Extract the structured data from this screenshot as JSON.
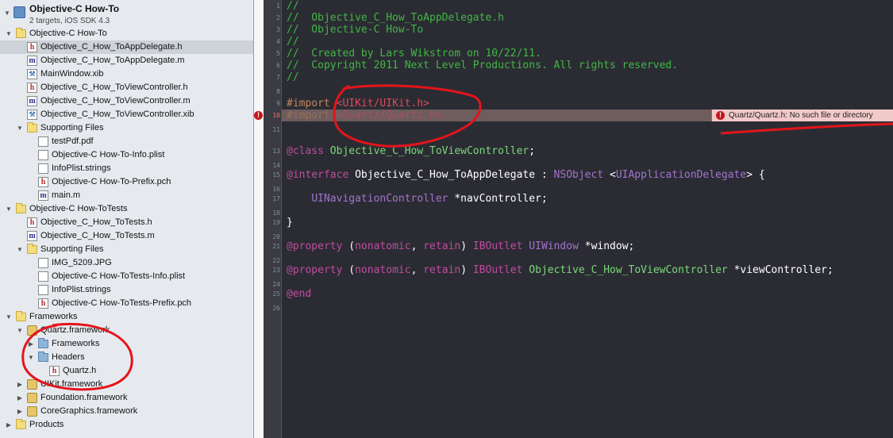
{
  "navigator": {
    "project": {
      "title": "Objective-C How-To",
      "subtitle": "2 targets, iOS SDK 4.3"
    },
    "rows": [
      {
        "label": "Objective-C How-To",
        "icon": "folder-icon",
        "kind": "folder",
        "tri": "▼",
        "indent": 0
      },
      {
        "label": "Objective_C_How_ToAppDelegate.h",
        "icon": "header-file-icon",
        "kind": "hfile",
        "tri": "",
        "indent": 1,
        "selected": true
      },
      {
        "label": "Objective_C_How_ToAppDelegate.m",
        "icon": "implementation-file-icon",
        "kind": "mfile",
        "tri": "",
        "indent": 1
      },
      {
        "label": "MainWindow.xib",
        "icon": "xib-file-icon",
        "kind": "xib",
        "tri": "",
        "indent": 1
      },
      {
        "label": "Objective_C_How_ToViewController.h",
        "icon": "header-file-icon",
        "kind": "hfile",
        "tri": "",
        "indent": 1
      },
      {
        "label": "Objective_C_How_ToViewController.m",
        "icon": "implementation-file-icon",
        "kind": "mfile",
        "tri": "",
        "indent": 1
      },
      {
        "label": "Objective_C_How_ToViewController.xib",
        "icon": "xib-file-icon",
        "kind": "xib",
        "tri": "",
        "indent": 1
      },
      {
        "label": "Supporting Files",
        "icon": "folder-icon",
        "kind": "folder",
        "tri": "▼",
        "indent": 1
      },
      {
        "label": "testPdf.pdf",
        "icon": "document-icon",
        "kind": "doc",
        "tri": "",
        "indent": 2
      },
      {
        "label": "Objective-C How-To-Info.plist",
        "icon": "document-icon",
        "kind": "doc",
        "tri": "",
        "indent": 2
      },
      {
        "label": "InfoPlist.strings",
        "icon": "document-icon",
        "kind": "doc",
        "tri": "",
        "indent": 2
      },
      {
        "label": "Objective-C How-To-Prefix.pch",
        "icon": "header-file-icon",
        "kind": "hfile",
        "tri": "",
        "indent": 2
      },
      {
        "label": "main.m",
        "icon": "implementation-file-icon",
        "kind": "mfile",
        "tri": "",
        "indent": 2
      },
      {
        "label": "Objective-C How-ToTests",
        "icon": "folder-icon",
        "kind": "folder",
        "tri": "▼",
        "indent": 0
      },
      {
        "label": "Objective_C_How_ToTests.h",
        "icon": "header-file-icon",
        "kind": "hfile",
        "tri": "",
        "indent": 1
      },
      {
        "label": "Objective_C_How_ToTests.m",
        "icon": "implementation-file-icon",
        "kind": "mfile",
        "tri": "",
        "indent": 1
      },
      {
        "label": "Supporting Files",
        "icon": "folder-icon",
        "kind": "folder",
        "tri": "▼",
        "indent": 1
      },
      {
        "label": "IMG_5209.JPG",
        "icon": "document-icon",
        "kind": "doc",
        "tri": "",
        "indent": 2
      },
      {
        "label": "Objective-C How-ToTests-Info.plist",
        "icon": "document-icon",
        "kind": "doc",
        "tri": "",
        "indent": 2
      },
      {
        "label": "InfoPlist.strings",
        "icon": "document-icon",
        "kind": "doc",
        "tri": "",
        "indent": 2
      },
      {
        "label": "Objective-C How-ToTests-Prefix.pch",
        "icon": "header-file-icon",
        "kind": "hfile",
        "tri": "",
        "indent": 2
      },
      {
        "label": "Frameworks",
        "icon": "folder-icon",
        "kind": "folder",
        "tri": "▼",
        "indent": 0
      },
      {
        "label": "Quartz.framework",
        "icon": "framework-icon",
        "kind": "fw",
        "tri": "▼",
        "indent": 1
      },
      {
        "label": "Frameworks",
        "icon": "blue-folder-icon",
        "kind": "bfolder",
        "tri": "▶",
        "indent": 2
      },
      {
        "label": "Headers",
        "icon": "blue-folder-icon",
        "kind": "bfolder",
        "tri": "▼",
        "indent": 2
      },
      {
        "label": "Quartz.h",
        "icon": "header-file-icon",
        "kind": "hfile",
        "tri": "",
        "indent": 3
      },
      {
        "label": "UIKit.framework",
        "icon": "framework-icon",
        "kind": "fw",
        "tri": "▶",
        "indent": 1
      },
      {
        "label": "Foundation.framework",
        "icon": "framework-icon",
        "kind": "fw",
        "tri": "▶",
        "indent": 1
      },
      {
        "label": "CoreGraphics.framework",
        "icon": "framework-icon",
        "kind": "fw",
        "tri": "▶",
        "indent": 1
      },
      {
        "label": "Products",
        "icon": "folder-icon",
        "kind": "folder",
        "tri": "▶",
        "indent": 0
      }
    ]
  },
  "editor": {
    "error_line_number": 10,
    "lines": [
      {
        "n": 1,
        "parts": [
          {
            "t": "//",
            "c": "com"
          }
        ]
      },
      {
        "n": 2,
        "parts": [
          {
            "t": "//  Objective_C_How_ToAppDelegate.h",
            "c": "com"
          }
        ]
      },
      {
        "n": 3,
        "parts": [
          {
            "t": "//  Objective-C How-To",
            "c": "com"
          }
        ]
      },
      {
        "n": 4,
        "parts": [
          {
            "t": "//",
            "c": "com"
          }
        ]
      },
      {
        "n": 5,
        "parts": [
          {
            "t": "//  Created by Lars Wikstrom on 10/22/11.",
            "c": "com"
          }
        ]
      },
      {
        "n": 6,
        "parts": [
          {
            "t": "//  Copyright 2011 Next Level Productions. All rights reserved.",
            "c": "com"
          }
        ]
      },
      {
        "n": 7,
        "parts": [
          {
            "t": "//",
            "c": "com"
          }
        ]
      },
      {
        "n": 8,
        "parts": []
      },
      {
        "n": 9,
        "parts": [
          {
            "t": "#import ",
            "c": "pre"
          },
          {
            "t": "<UIKit/UIKit.h>",
            "c": "str"
          }
        ]
      },
      {
        "n": 10,
        "parts": [
          {
            "t": "#import ",
            "c": "pre"
          },
          {
            "t": "<Quartz/Quartz.h>",
            "c": "str"
          }
        ]
      },
      {
        "n": 11,
        "parts": []
      },
      {
        "n": 13,
        "parts": [
          {
            "t": "@class ",
            "c": "kw"
          },
          {
            "t": "Objective_C_How_ToViewController",
            "c": "cls"
          },
          {
            "t": ";",
            "c": "plain"
          }
        ]
      },
      {
        "n": 14,
        "parts": []
      },
      {
        "n": 15,
        "parts": [
          {
            "t": "@interface ",
            "c": "kw"
          },
          {
            "t": "Objective_C_How_ToAppDelegate : ",
            "c": "plain"
          },
          {
            "t": "NSObject",
            "c": "sys"
          },
          {
            "t": " <",
            "c": "plain"
          },
          {
            "t": "UIApplicationDelegate",
            "c": "sys"
          },
          {
            "t": "> {",
            "c": "plain"
          }
        ]
      },
      {
        "n": 16,
        "parts": []
      },
      {
        "n": 17,
        "parts": [
          {
            "t": "    ",
            "c": "plain"
          },
          {
            "t": "UINavigationController",
            "c": "sys"
          },
          {
            "t": " *navController;",
            "c": "plain"
          }
        ]
      },
      {
        "n": 18,
        "parts": []
      },
      {
        "n": 19,
        "parts": [
          {
            "t": "}",
            "c": "plain"
          }
        ]
      },
      {
        "n": 20,
        "parts": []
      },
      {
        "n": 21,
        "parts": [
          {
            "t": "@property",
            "c": "kw"
          },
          {
            "t": " (",
            "c": "plain"
          },
          {
            "t": "nonatomic",
            "c": "kw"
          },
          {
            "t": ", ",
            "c": "plain"
          },
          {
            "t": "retain",
            "c": "kw"
          },
          {
            "t": ") ",
            "c": "plain"
          },
          {
            "t": "IBOutlet",
            "c": "kw"
          },
          {
            "t": " ",
            "c": "plain"
          },
          {
            "t": "UIWindow",
            "c": "sys"
          },
          {
            "t": " *window;",
            "c": "plain"
          }
        ]
      },
      {
        "n": 22,
        "parts": []
      },
      {
        "n": 23,
        "parts": [
          {
            "t": "@property",
            "c": "kw"
          },
          {
            "t": " (",
            "c": "plain"
          },
          {
            "t": "nonatomic",
            "c": "kw"
          },
          {
            "t": ", ",
            "c": "plain"
          },
          {
            "t": "retain",
            "c": "kw"
          },
          {
            "t": ") ",
            "c": "plain"
          },
          {
            "t": "IBOutlet",
            "c": "kw"
          },
          {
            "t": " ",
            "c": "plain"
          },
          {
            "t": "Objective_C_How_ToViewController",
            "c": "cls"
          },
          {
            "t": " *viewController;",
            "c": "plain"
          }
        ]
      },
      {
        "n": 24,
        "parts": []
      },
      {
        "n": 25,
        "parts": [
          {
            "t": "@end",
            "c": "kw"
          }
        ]
      },
      {
        "n": 26,
        "parts": []
      }
    ]
  },
  "error": {
    "icon": "error-icon",
    "symbol": "!",
    "message": "Quartz/Quartz.h: No such file or directory"
  },
  "colors": {
    "editor_bg": "#2b2c33",
    "comment": "#41b645",
    "keyword": "#c14ba0",
    "string": "#dd4a5a",
    "annotation_red": "#e4141b"
  }
}
